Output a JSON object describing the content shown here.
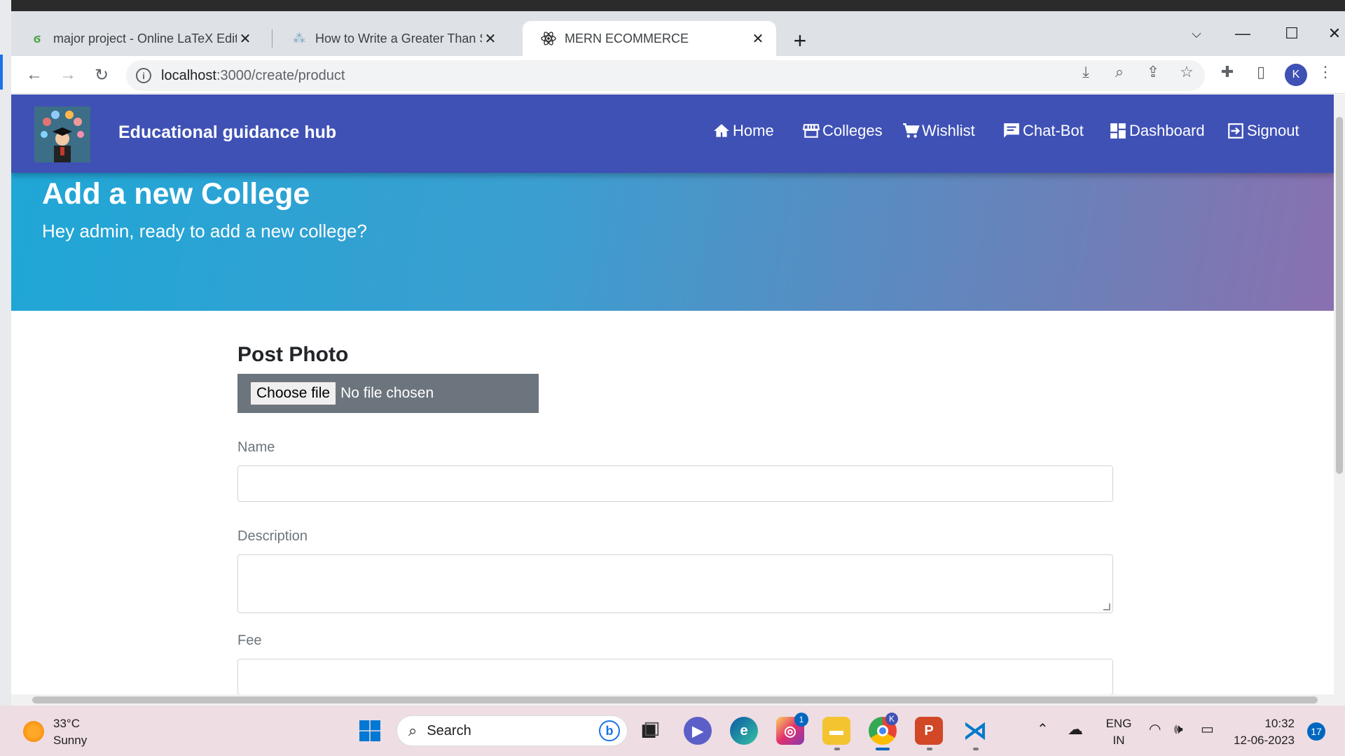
{
  "browser": {
    "tabs": [
      {
        "title": "major project - Online LaTeX Edit",
        "icon": "overleaf-icon"
      },
      {
        "title": "How to Write a Greater Than Sym",
        "icon": "loading-icon"
      },
      {
        "title": "MERN ECOMMERCE",
        "icon": "react-icon"
      }
    ],
    "url_host": "localhost",
    "url_path": ":3000/create/product",
    "profile_initial": "K"
  },
  "navbar": {
    "brand": "Educational guidance hub",
    "links": [
      {
        "label": "Home",
        "icon": "home-icon"
      },
      {
        "label": "Colleges",
        "icon": "store-icon"
      },
      {
        "label": "Wishlist",
        "icon": "cart-icon"
      },
      {
        "label": "Chat-Bot",
        "icon": "chat-icon"
      },
      {
        "label": "Dashboard",
        "icon": "dashboard-icon"
      },
      {
        "label": "Signout",
        "icon": "signout-icon"
      }
    ]
  },
  "hero": {
    "title": "Add a new College",
    "subtitle": "Hey admin, ready to add a new college?"
  },
  "form": {
    "photo_heading": "Post Photo",
    "choose_file": "Choose file",
    "no_file": "No file chosen",
    "name_label": "Name",
    "description_label": "Description",
    "fee_label": "Fee"
  },
  "taskbar": {
    "temperature": "33°C",
    "weather": "Sunny",
    "search_placeholder": "Search",
    "instagram_badge": "1",
    "language_line1": "ENG",
    "language_line2": "IN",
    "time": "10:32",
    "date": "12-06-2023",
    "notifications": "17"
  },
  "colors": {
    "navbar": "#3f51b5",
    "hero_start": "#1fa7d6",
    "hero_end": "#8a70b0",
    "file_input_bg": "#6c757d"
  }
}
